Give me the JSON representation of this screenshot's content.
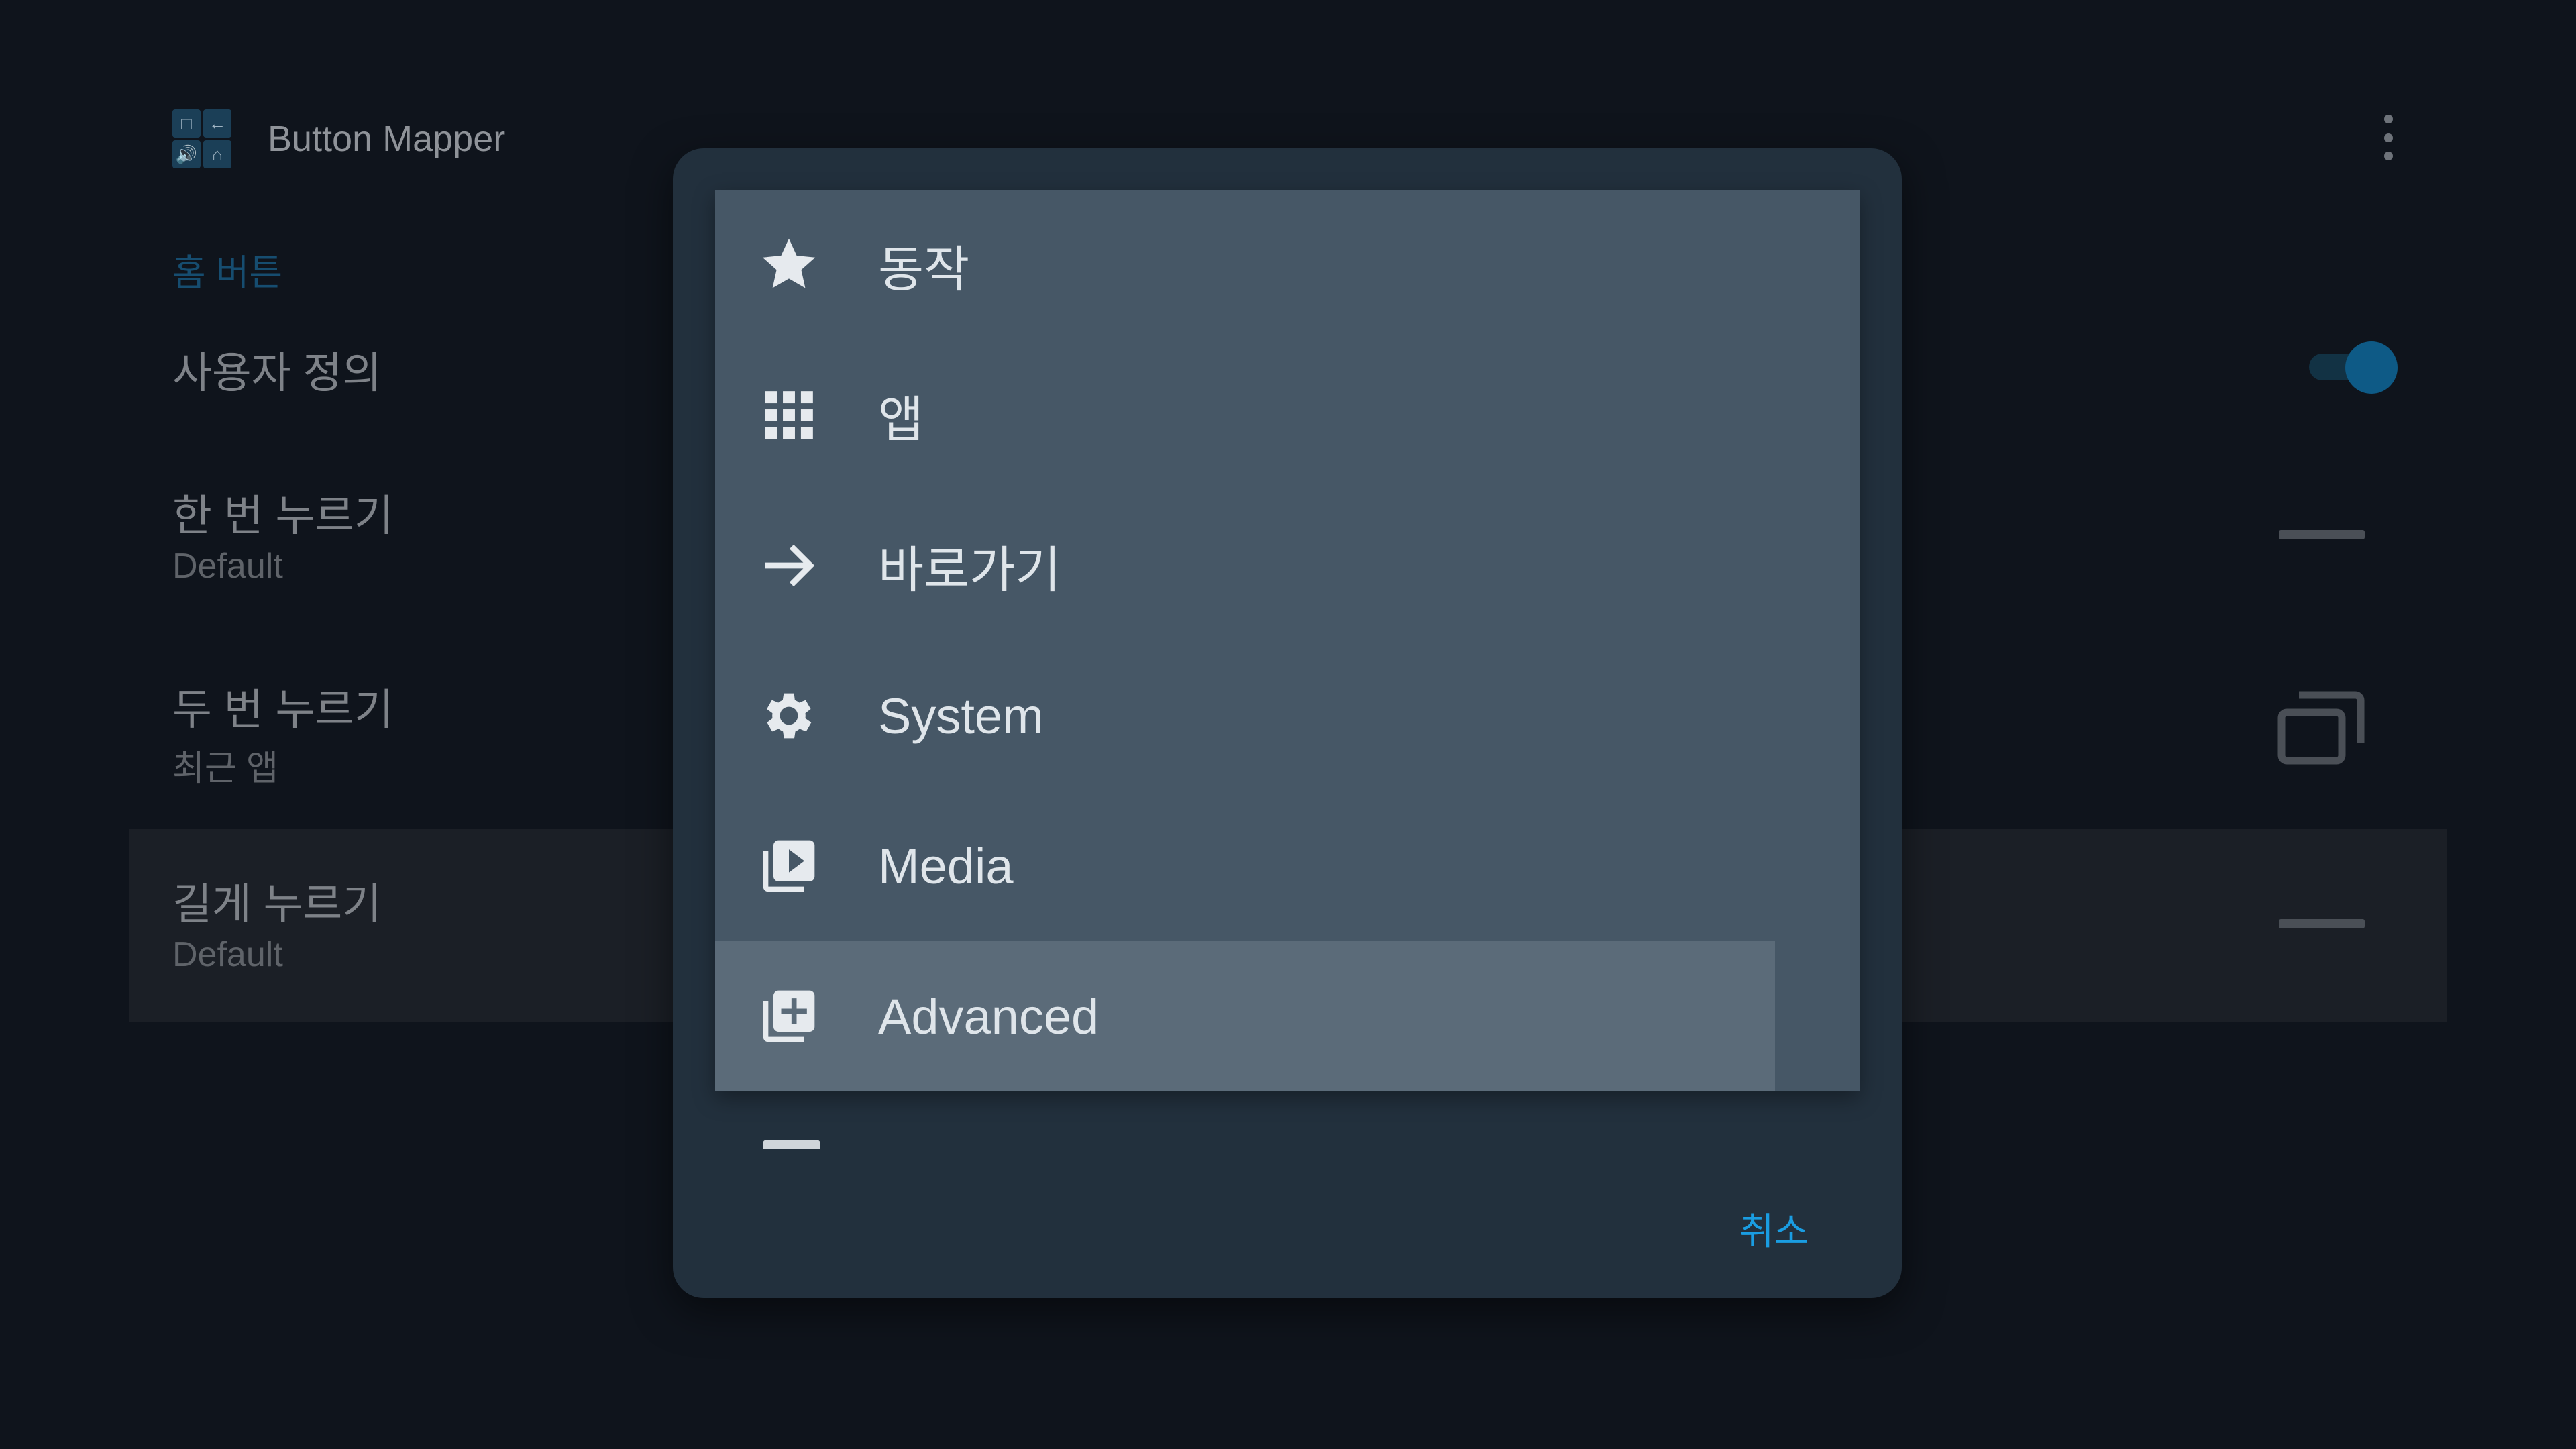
{
  "app": {
    "title": "Button Mapper",
    "logo_tiles": [
      "□",
      "←",
      "🔊",
      "⌂"
    ]
  },
  "settings": {
    "section_label": "홈 버튼",
    "custom": {
      "label": "사용자 정의",
      "toggle_on": true
    },
    "single_press": {
      "label": "한 번 누르기",
      "value": "Default"
    },
    "double_press": {
      "label": "두 번 누르기",
      "value": "최근 앱"
    },
    "long_press": {
      "label": "길게 누르기",
      "value": "Default"
    }
  },
  "dialog": {
    "items": [
      {
        "label": "동작",
        "icon": "star-icon"
      },
      {
        "label": "앱",
        "icon": "apps-grid-icon"
      },
      {
        "label": "바로가기",
        "icon": "arrow-right-icon"
      },
      {
        "label": "System",
        "icon": "gear-icon"
      },
      {
        "label": "Media",
        "icon": "media-library-icon"
      },
      {
        "label": "Advanced",
        "icon": "add-library-icon",
        "focused": true
      }
    ],
    "cancel_label": "취소"
  },
  "colors": {
    "background": "#0f141c",
    "dialog": "#22303d",
    "menu_panel": "#465766",
    "focused_item": "#5b6b79",
    "accent": "#1a9de2"
  }
}
